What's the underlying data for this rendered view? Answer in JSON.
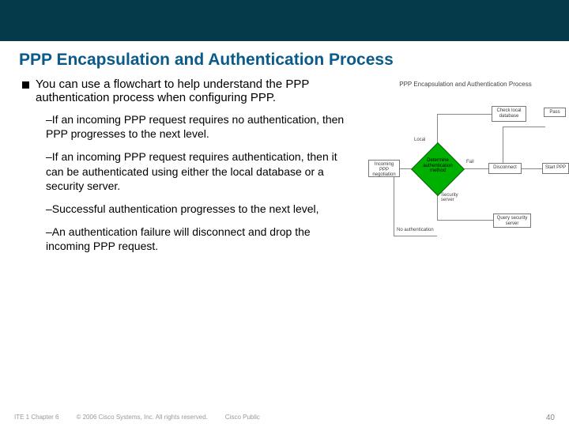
{
  "slide": {
    "title": "PPP Encapsulation and Authentication Process",
    "bullet": "You can use a flowchart to help understand the PPP authentication process when configuring PPP.",
    "subs": [
      "–If an incoming PPP request requires no authentication, then PPP progresses to the next level.",
      "–If an incoming PPP request requires authentication, then it can be authenticated using either the local database or a security server.",
      "–Successful authentication progresses to the next level,",
      "–An authentication failure will disconnect and drop the incoming PPP request."
    ]
  },
  "diagram": {
    "title": "PPP Encapsulation and Authentication Process",
    "incoming": "Incoming PPP negotiation",
    "determine": "Determine authentication method",
    "check_local": "Check local database",
    "pass": "Pass",
    "disconnect": "Disconnect",
    "start_ppp": "Start PPP",
    "query_sec": "Query security server",
    "lbl_local": "Local",
    "lbl_fail": "Fail",
    "lbl_sec": "Security server",
    "lbl_noauth": "No authentication"
  },
  "footer": {
    "left": "ITE 1 Chapter 6",
    "copyright": "© 2006 Cisco Systems, Inc. All rights reserved.",
    "public": "Cisco Public",
    "page": "40"
  }
}
